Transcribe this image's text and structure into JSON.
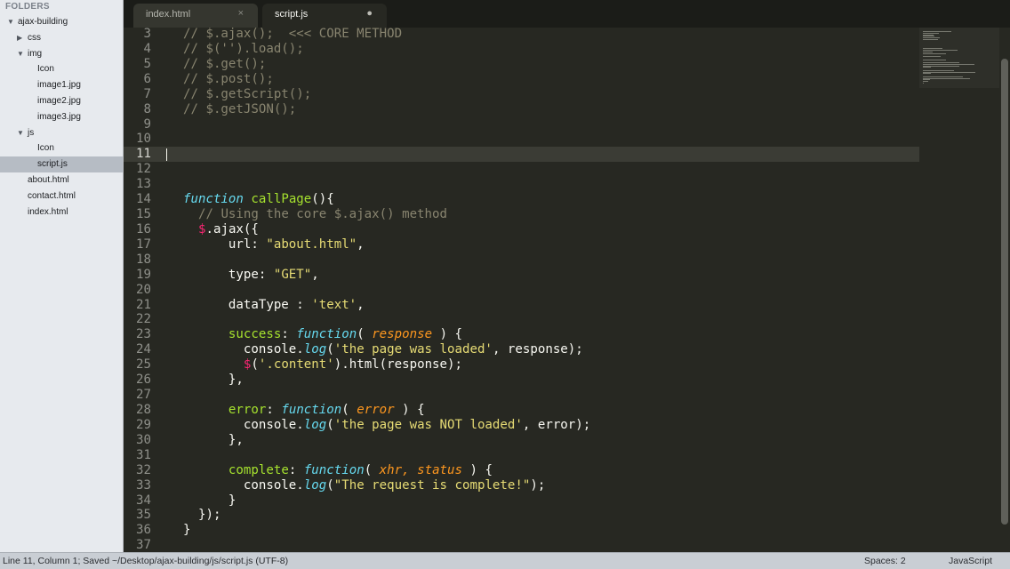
{
  "sidebar": {
    "header": "FOLDERS",
    "tree": [
      {
        "label": "ajax-building",
        "arrow": "▼",
        "depth": 0
      },
      {
        "label": "css",
        "arrow": "▶",
        "depth": 1
      },
      {
        "label": "img",
        "arrow": "▼",
        "depth": 1
      },
      {
        "label": "Icon",
        "arrow": "",
        "depth": 2
      },
      {
        "label": "image1.jpg",
        "arrow": "",
        "depth": 2
      },
      {
        "label": "image2.jpg",
        "arrow": "",
        "depth": 2
      },
      {
        "label": "image3.jpg",
        "arrow": "",
        "depth": 2
      },
      {
        "label": "js",
        "arrow": "▼",
        "depth": 1
      },
      {
        "label": "Icon",
        "arrow": "",
        "depth": 2
      },
      {
        "label": "script.js",
        "arrow": "",
        "depth": 2,
        "selected": true
      },
      {
        "label": "about.html",
        "arrow": "",
        "depth": 1
      },
      {
        "label": "contact.html",
        "arrow": "",
        "depth": 1
      },
      {
        "label": "index.html",
        "arrow": "",
        "depth": 1
      }
    ]
  },
  "tabs": [
    {
      "label": "index.html",
      "close": "×"
    },
    {
      "label": "script.js",
      "dot": "●"
    }
  ],
  "editor": {
    "current_line": 11,
    "lines": [
      {
        "n": "3",
        "tokens": [
          [
            "c",
            "// $.ajax();  <<< CORE METHOD"
          ]
        ]
      },
      {
        "n": "4",
        "tokens": [
          [
            "c",
            "// $('').load();"
          ]
        ]
      },
      {
        "n": "5",
        "tokens": [
          [
            "c",
            "// $.get();"
          ]
        ]
      },
      {
        "n": "6",
        "tokens": [
          [
            "c",
            "// $.post();"
          ]
        ]
      },
      {
        "n": "7",
        "tokens": [
          [
            "c",
            "// $.getScript();"
          ]
        ]
      },
      {
        "n": "8",
        "tokens": [
          [
            "c",
            "// $.getJSON();"
          ]
        ]
      },
      {
        "n": "9",
        "tokens": []
      },
      {
        "n": "10",
        "tokens": []
      },
      {
        "n": "11",
        "tokens": []
      },
      {
        "n": "12",
        "tokens": []
      },
      {
        "n": "13",
        "tokens": []
      },
      {
        "n": "14",
        "tokens": [
          [
            "k",
            "function"
          ],
          [
            "t",
            " "
          ],
          [
            "f",
            "callPage"
          ],
          [
            "t",
            "(){"
          ]
        ]
      },
      {
        "n": "15",
        "tokens": [
          [
            "t",
            "  "
          ],
          [
            "c",
            "// Using the core $.ajax() method"
          ]
        ]
      },
      {
        "n": "16",
        "tokens": [
          [
            "t",
            "  "
          ],
          [
            "r",
            "$"
          ],
          [
            "t",
            ".ajax({"
          ]
        ]
      },
      {
        "n": "17",
        "tokens": [
          [
            "t",
            "      url: "
          ],
          [
            "s",
            "\"about.html\""
          ],
          [
            "t",
            ","
          ]
        ]
      },
      {
        "n": "18",
        "tokens": []
      },
      {
        "n": "19",
        "tokens": [
          [
            "t",
            "      type: "
          ],
          [
            "s",
            "\"GET\""
          ],
          [
            "t",
            ","
          ]
        ]
      },
      {
        "n": "20",
        "tokens": []
      },
      {
        "n": "21",
        "tokens": [
          [
            "t",
            "      dataType : "
          ],
          [
            "s",
            "'text'"
          ],
          [
            "t",
            ","
          ]
        ]
      },
      {
        "n": "22",
        "tokens": []
      },
      {
        "n": "23",
        "tokens": [
          [
            "t",
            "      "
          ],
          [
            "f",
            "success"
          ],
          [
            "t",
            ": "
          ],
          [
            "k",
            "function"
          ],
          [
            "t",
            "( "
          ],
          [
            "p",
            "response"
          ],
          [
            "t",
            " ) {"
          ]
        ]
      },
      {
        "n": "24",
        "tokens": [
          [
            "t",
            "        console."
          ],
          [
            "k",
            "log"
          ],
          [
            "t",
            "("
          ],
          [
            "s",
            "'the page was loaded'"
          ],
          [
            "t",
            ", response);"
          ]
        ]
      },
      {
        "n": "25",
        "tokens": [
          [
            "t",
            "        "
          ],
          [
            "r",
            "$"
          ],
          [
            "t",
            "("
          ],
          [
            "s",
            "'.content'"
          ],
          [
            "t",
            ").html(response);"
          ]
        ]
      },
      {
        "n": "26",
        "tokens": [
          [
            "t",
            "      },"
          ]
        ]
      },
      {
        "n": "27",
        "tokens": []
      },
      {
        "n": "28",
        "tokens": [
          [
            "t",
            "      "
          ],
          [
            "f",
            "error"
          ],
          [
            "t",
            ": "
          ],
          [
            "k",
            "function"
          ],
          [
            "t",
            "( "
          ],
          [
            "p",
            "error"
          ],
          [
            "t",
            " ) {"
          ]
        ]
      },
      {
        "n": "29",
        "tokens": [
          [
            "t",
            "        console."
          ],
          [
            "k",
            "log"
          ],
          [
            "t",
            "("
          ],
          [
            "s",
            "'the page was NOT loaded'"
          ],
          [
            "t",
            ", error);"
          ]
        ]
      },
      {
        "n": "30",
        "tokens": [
          [
            "t",
            "      },"
          ]
        ]
      },
      {
        "n": "31",
        "tokens": []
      },
      {
        "n": "32",
        "tokens": [
          [
            "t",
            "      "
          ],
          [
            "f",
            "complete"
          ],
          [
            "t",
            ": "
          ],
          [
            "k",
            "function"
          ],
          [
            "t",
            "( "
          ],
          [
            "p",
            "xhr, status"
          ],
          [
            "t",
            " ) {"
          ]
        ]
      },
      {
        "n": "33",
        "tokens": [
          [
            "t",
            "        console."
          ],
          [
            "k",
            "log"
          ],
          [
            "t",
            "("
          ],
          [
            "s",
            "\"The request is complete!\""
          ],
          [
            "t",
            ");"
          ]
        ]
      },
      {
        "n": "34",
        "tokens": [
          [
            "t",
            "      }"
          ]
        ]
      },
      {
        "n": "35",
        "tokens": [
          [
            "t",
            "  });"
          ]
        ]
      },
      {
        "n": "36",
        "tokens": [
          [
            "t",
            "}"
          ]
        ]
      },
      {
        "n": "37",
        "tokens": []
      }
    ]
  },
  "status": {
    "left": "Line 11, Column 1; Saved ~/Desktop/ajax-building/js/script.js (UTF-8)",
    "spaces": "Spaces: 2",
    "syntax": "JavaScript"
  },
  "colors": {
    "editor_bg": "#272822",
    "comment": "#88846f",
    "keyword": "#66d9ef",
    "function_name": "#a6e22e",
    "string": "#e6db74",
    "parameter": "#fd971f",
    "dollar": "#f92672"
  }
}
